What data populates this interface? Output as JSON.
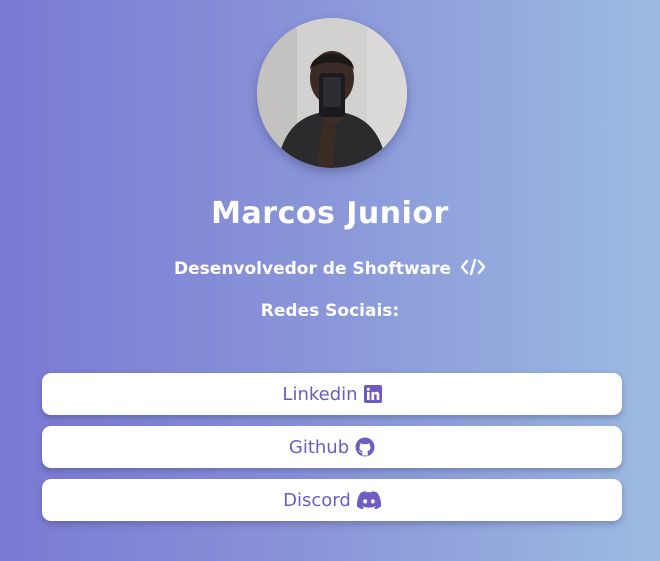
{
  "profile": {
    "name": "Marcos Junior",
    "role": "Desenvolvedor de Shoftware",
    "role_icon": "code-icon",
    "avatar": "profile-photo"
  },
  "social": {
    "heading": "Redes Sociais:",
    "links": [
      {
        "label": "Linkedin",
        "icon": "linkedin-icon"
      },
      {
        "label": "Github",
        "icon": "github-icon"
      },
      {
        "label": "Discord",
        "icon": "discord-icon"
      }
    ]
  },
  "colors": {
    "background_start": "#7b79d3",
    "background_end": "#9dbbe2",
    "button_background": "#ffffff",
    "button_text": "#6e5bc4",
    "text": "#ffffff"
  }
}
